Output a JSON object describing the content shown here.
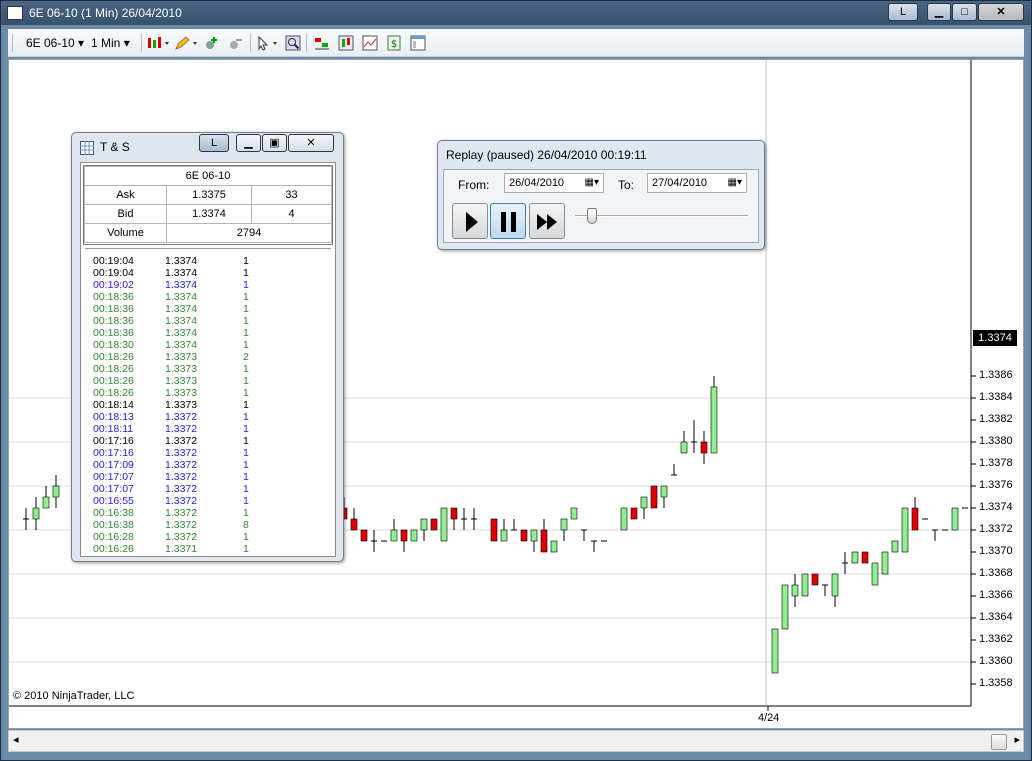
{
  "window": {
    "title": "6E 06-10 (1 Min)  26/04/2010",
    "btn_l": "L"
  },
  "toolbar": {
    "instrument": "6E 06-10",
    "interval": "1 Min",
    "icons": [
      "candlestick-icon",
      "pencil-icon",
      "add-indicator-icon",
      "remove-indicator-icon",
      "cursor-icon",
      "zoom-icon",
      "strategy-icon",
      "chart-style-icon",
      "chart-properties-icon",
      "dollar-icon",
      "data-box-icon"
    ]
  },
  "ts": {
    "title": "T & S",
    "btn_l": "L",
    "instrument": "6E 06-10",
    "ask_label": "Ask",
    "ask_price": "1.3375",
    "ask_size": "33",
    "bid_label": "Bid",
    "bid_price": "1.3374",
    "bid_size": "4",
    "volume_label": "Volume",
    "volume": "2794",
    "rows": [
      {
        "time": "00:19:04",
        "price": "1.3374",
        "size": "1",
        "color": "#000000"
      },
      {
        "time": "00:19:04",
        "price": "1.3374",
        "size": "1",
        "color": "#000000"
      },
      {
        "time": "00:19:02",
        "price": "1.3374",
        "size": "1",
        "color": "#1f1fd0"
      },
      {
        "time": "00:18:36",
        "price": "1.3374",
        "size": "1",
        "color": "#2e8b2e"
      },
      {
        "time": "00:18:36",
        "price": "1.3374",
        "size": "1",
        "color": "#2e8b2e"
      },
      {
        "time": "00:18:36",
        "price": "1.3374",
        "size": "1",
        "color": "#2e8b2e"
      },
      {
        "time": "00:18:36",
        "price": "1.3374",
        "size": "1",
        "color": "#2e8b2e"
      },
      {
        "time": "00:18:30",
        "price": "1.3374",
        "size": "1",
        "color": "#2e8b2e"
      },
      {
        "time": "00:18:26",
        "price": "1.3373",
        "size": "2",
        "color": "#2e8b2e"
      },
      {
        "time": "00:18:26",
        "price": "1.3373",
        "size": "1",
        "color": "#2e8b2e"
      },
      {
        "time": "00:18:26",
        "price": "1.3373",
        "size": "1",
        "color": "#2e8b2e"
      },
      {
        "time": "00:18:26",
        "price": "1.3373",
        "size": "1",
        "color": "#2e8b2e"
      },
      {
        "time": "00:18:14",
        "price": "1.3373",
        "size": "1",
        "color": "#000000"
      },
      {
        "time": "00:18:13",
        "price": "1.3372",
        "size": "1",
        "color": "#1f1fd0"
      },
      {
        "time": "00:18:11",
        "price": "1.3372",
        "size": "1",
        "color": "#1f1fd0"
      },
      {
        "time": "00:17:16",
        "price": "1.3372",
        "size": "1",
        "color": "#000000"
      },
      {
        "time": "00:17:16",
        "price": "1.3372",
        "size": "1",
        "color": "#1f1fd0"
      },
      {
        "time": "00:17:09",
        "price": "1.3372",
        "size": "1",
        "color": "#1f1fd0"
      },
      {
        "time": "00:17:07",
        "price": "1.3372",
        "size": "1",
        "color": "#1f1fd0"
      },
      {
        "time": "00:17:07",
        "price": "1.3372",
        "size": "1",
        "color": "#1f1fd0"
      },
      {
        "time": "00:16:55",
        "price": "1.3372",
        "size": "1",
        "color": "#1f1fd0"
      },
      {
        "time": "00:16:38",
        "price": "1.3372",
        "size": "1",
        "color": "#2e8b2e"
      },
      {
        "time": "00:16:38",
        "price": "1.3372",
        "size": "8",
        "color": "#2e8b2e"
      },
      {
        "time": "00:16:28",
        "price": "1.3372",
        "size": "1",
        "color": "#2e8b2e"
      },
      {
        "time": "00:16:26",
        "price": "1.3371",
        "size": "1",
        "color": "#2e8b2e"
      }
    ]
  },
  "replay": {
    "title": "Replay (paused) 26/04/2010 00:19:11",
    "from_label": "From:",
    "from_value": "26/04/2010",
    "to_label": "To:",
    "to_value": "27/04/2010"
  },
  "chart": {
    "copyright": "© 2010 NinjaTrader, LLC",
    "x_tick": "4/24",
    "current_price": "1.3374",
    "y_ticks": [
      "1.3386",
      "1.3384",
      "1.3382",
      "1.3380",
      "1.3378",
      "1.3376",
      "1.3374",
      "1.3372",
      "1.3370",
      "1.3368",
      "1.3366",
      "1.3364",
      "1.3362",
      "1.3360",
      "1.3358"
    ]
  },
  "chart_data": {
    "type": "candlestick",
    "ylim": [
      1.3357,
      1.3387
    ],
    "up_color": "#90ee90",
    "down_color": "#e00000",
    "candles": [
      {
        "o": 1.3373,
        "h": 1.3374,
        "l": 1.3372,
        "c": 1.3373
      },
      {
        "o": 1.3373,
        "h": 1.3375,
        "l": 1.3372,
        "c": 1.3374
      },
      {
        "o": 1.3374,
        "h": 1.3376,
        "l": 1.3374,
        "c": 1.3375
      },
      {
        "o": 1.3375,
        "h": 1.3377,
        "l": 1.3374,
        "c": 1.3376
      },
      {
        "o": 1.3374,
        "h": 1.3375,
        "l": 1.3373,
        "c": 1.3373
      },
      {
        "o": 1.3373,
        "h": 1.3374,
        "l": 1.3372,
        "c": 1.3372
      },
      {
        "o": 1.3372,
        "h": 1.3372,
        "l": 1.3371,
        "c": 1.3371
      },
      {
        "o": 1.3371,
        "h": 1.3372,
        "l": 1.337,
        "c": 1.3371
      },
      {
        "o": 1.3371,
        "h": 1.3371,
        "l": 1.3371,
        "c": 1.3371
      },
      {
        "o": 1.3371,
        "h": 1.3373,
        "l": 1.3371,
        "c": 1.3372
      },
      {
        "o": 1.3372,
        "h": 1.3372,
        "l": 1.337,
        "c": 1.3371
      },
      {
        "o": 1.3371,
        "h": 1.3372,
        "l": 1.3371,
        "c": 1.3372
      },
      {
        "o": 1.3372,
        "h": 1.3373,
        "l": 1.3371,
        "c": 1.3373
      },
      {
        "o": 1.3373,
        "h": 1.3373,
        "l": 1.3372,
        "c": 1.3372
      },
      {
        "o": 1.3371,
        "h": 1.3374,
        "l": 1.3371,
        "c": 1.3374
      },
      {
        "o": 1.3374,
        "h": 1.3374,
        "l": 1.3372,
        "c": 1.3373
      },
      {
        "o": 1.3373,
        "h": 1.3374,
        "l": 1.3372,
        "c": 1.3373
      },
      {
        "o": 1.3373,
        "h": 1.3374,
        "l": 1.3372,
        "c": 1.3373
      },
      {
        "o": 1.3373,
        "h": 1.3373,
        "l": 1.3371,
        "c": 1.3371
      },
      {
        "o": 1.3371,
        "h": 1.3373,
        "l": 1.3371,
        "c": 1.3372
      },
      {
        "o": 1.3372,
        "h": 1.3373,
        "l": 1.3372,
        "c": 1.3372
      },
      {
        "o": 1.3372,
        "h": 1.3372,
        "l": 1.3371,
        "c": 1.3371
      },
      {
        "o": 1.3371,
        "h": 1.3372,
        "l": 1.337,
        "c": 1.3372
      },
      {
        "o": 1.3372,
        "h": 1.3373,
        "l": 1.337,
        "c": 1.337
      },
      {
        "o": 1.337,
        "h": 1.3371,
        "l": 1.337,
        "c": 1.3371
      },
      {
        "o": 1.3372,
        "h": 1.3373,
        "l": 1.3371,
        "c": 1.3373
      },
      {
        "o": 1.3373,
        "h": 1.3374,
        "l": 1.3373,
        "c": 1.3374
      },
      {
        "o": 1.3372,
        "h": 1.3372,
        "l": 1.3371,
        "c": 1.3372
      },
      {
        "o": 1.3371,
        "h": 1.3371,
        "l": 1.337,
        "c": 1.3371
      },
      {
        "o": 1.3371,
        "h": 1.3371,
        "l": 1.3371,
        "c": 1.3371
      },
      {
        "o": 1.3372,
        "h": 1.3374,
        "l": 1.3372,
        "c": 1.3374
      },
      {
        "o": 1.3374,
        "h": 1.3374,
        "l": 1.3373,
        "c": 1.3373
      },
      {
        "o": 1.3374,
        "h": 1.3375,
        "l": 1.3373,
        "c": 1.3375
      },
      {
        "o": 1.3376,
        "h": 1.3376,
        "l": 1.3374,
        "c": 1.3374
      },
      {
        "o": 1.3375,
        "h": 1.3376,
        "l": 1.3374,
        "c": 1.3376
      },
      {
        "o": 1.3377,
        "h": 1.3378,
        "l": 1.3377,
        "c": 1.3377
      },
      {
        "o": 1.3379,
        "h": 1.3381,
        "l": 1.3379,
        "c": 1.338
      },
      {
        "o": 1.338,
        "h": 1.3382,
        "l": 1.3379,
        "c": 1.338
      },
      {
        "o": 1.338,
        "h": 1.3381,
        "l": 1.3378,
        "c": 1.3379
      },
      {
        "o": 1.3379,
        "h": 1.3386,
        "l": 1.3379,
        "c": 1.3385
      },
      {
        "o": 1.3359,
        "h": 1.3363,
        "l": 1.3359,
        "c": 1.3363
      },
      {
        "o": 1.3363,
        "h": 1.3367,
        "l": 1.3363,
        "c": 1.3367
      },
      {
        "o": 1.3366,
        "h": 1.3368,
        "l": 1.3365,
        "c": 1.3367
      },
      {
        "o": 1.3366,
        "h": 1.3368,
        "l": 1.3366,
        "c": 1.3368
      },
      {
        "o": 1.3368,
        "h": 1.3368,
        "l": 1.3367,
        "c": 1.3367
      },
      {
        "o": 1.3367,
        "h": 1.3367,
        "l": 1.3366,
        "c": 1.3367
      },
      {
        "o": 1.3366,
        "h": 1.3368,
        "l": 1.3365,
        "c": 1.3368
      },
      {
        "o": 1.3369,
        "h": 1.337,
        "l": 1.3368,
        "c": 1.3369
      },
      {
        "o": 1.3369,
        "h": 1.337,
        "l": 1.3369,
        "c": 1.337
      },
      {
        "o": 1.337,
        "h": 1.337,
        "l": 1.3369,
        "c": 1.3369
      },
      {
        "o": 1.3367,
        "h": 1.3369,
        "l": 1.3367,
        "c": 1.3369
      },
      {
        "o": 1.3368,
        "h": 1.337,
        "l": 1.3368,
        "c": 1.337
      },
      {
        "o": 1.337,
        "h": 1.3371,
        "l": 1.337,
        "c": 1.3371
      },
      {
        "o": 1.337,
        "h": 1.3374,
        "l": 1.337,
        "c": 1.3374
      },
      {
        "o": 1.3374,
        "h": 1.3375,
        "l": 1.3372,
        "c": 1.3372
      },
      {
        "o": 1.3373,
        "h": 1.3373,
        "l": 1.3373,
        "c": 1.3373
      },
      {
        "o": 1.3372,
        "h": 1.3372,
        "l": 1.3371,
        "c": 1.3372
      },
      {
        "o": 1.3372,
        "h": 1.3372,
        "l": 1.3372,
        "c": 1.3372
      },
      {
        "o": 1.3372,
        "h": 1.3374,
        "l": 1.3372,
        "c": 1.3374
      },
      {
        "o": 1.3374,
        "h": 1.3374,
        "l": 1.3374,
        "c": 1.3374
      }
    ]
  }
}
